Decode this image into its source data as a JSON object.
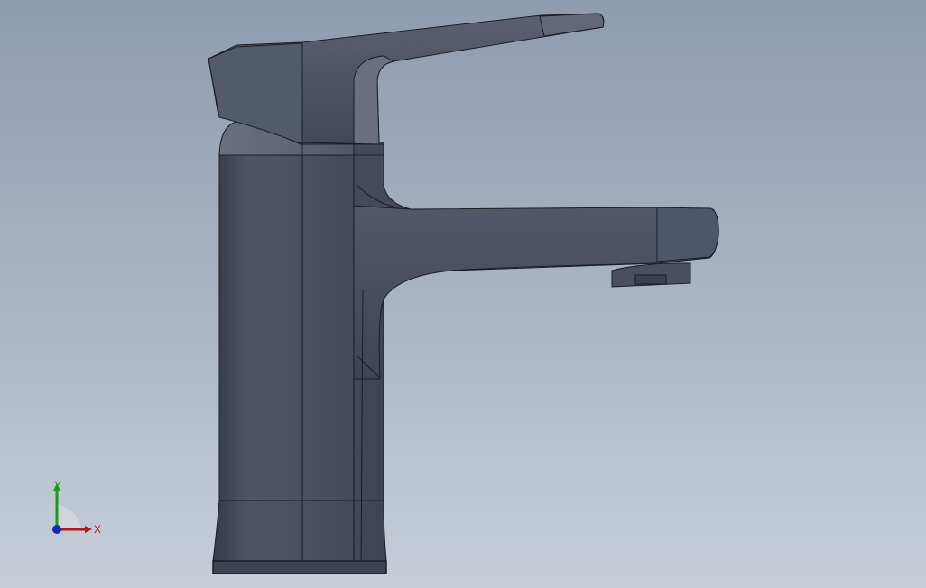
{
  "viewport": {
    "background_top": "#8d9caf",
    "background_bottom": "#c7ced8",
    "model_fill": "#4a5060",
    "model_edge": "#1a1d24"
  },
  "triad": {
    "x_label": "X",
    "y_label": "Y",
    "x_color": "#b01818",
    "y_color": "#1a9a1a",
    "z_color": "#1a2ab0"
  }
}
